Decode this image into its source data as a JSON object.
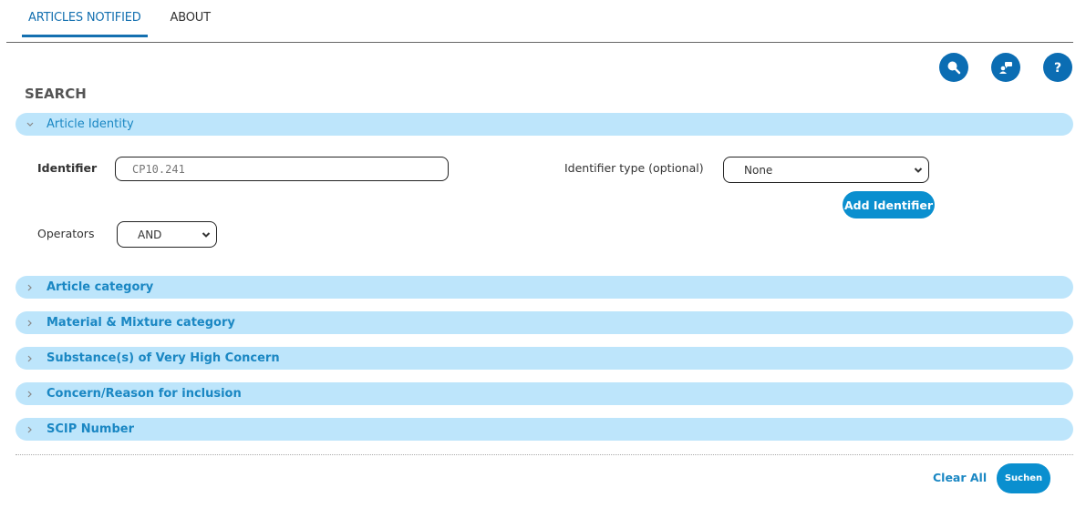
{
  "tabs": [
    {
      "label": "ARTICLES NOTIFIED",
      "active": true
    },
    {
      "label": "ABOUT",
      "active": false
    }
  ],
  "toolbar": {
    "icons": [
      "search-icon",
      "feedback-icon",
      "help-icon"
    ]
  },
  "page": {
    "title": "SEARCH"
  },
  "article_identity": {
    "header": "Article Identity",
    "identifier_label": "Identifier",
    "identifier_value": "CP10.241",
    "identifier_type_label": "Identifier type (optional)",
    "identifier_type_value": "None",
    "add_identifier_label": "Add Identifier",
    "operators_label": "Operators",
    "operators_value": "AND"
  },
  "sections": [
    {
      "label": "Article category"
    },
    {
      "label": "Material & Mixture category"
    },
    {
      "label": "Substance(s) of Very High Concern"
    },
    {
      "label": "Concern/Reason for inclusion"
    },
    {
      "label": "SCIP Number"
    }
  ],
  "footer": {
    "clear_all_label": "Clear All",
    "search_label": "Suchen"
  },
  "colors": {
    "accent": "#0b6db3",
    "panel_bg": "#bde5fb",
    "panel_text": "#1a87c3",
    "button": "#0a8fcf"
  }
}
